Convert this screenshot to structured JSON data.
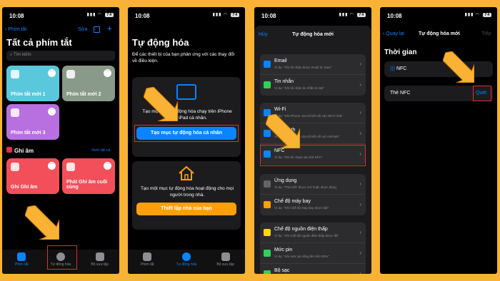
{
  "status": {
    "time": "10:08",
    "battery": "74"
  },
  "p1": {
    "back": "Phím tắt",
    "edit": "Sửa",
    "title": "Tất cả phím tắt",
    "search_placeholder": "Tìm kiếm",
    "cards": [
      "Phím tắt mới 1",
      "Phím tắt mới 2",
      "Phím tắt mới 3"
    ],
    "section": "Ghi âm",
    "see_all": "Xem tất cả",
    "rec_cards": [
      "Ghi Ghi âm",
      "Phát Ghi âm cuối cùng"
    ],
    "tabs": [
      "Phím tắt",
      "Tự động hóa",
      "Bộ sưu tập"
    ]
  },
  "p2": {
    "title": "Tự động hóa",
    "desc": "Để các thiết bị của bạn phản ứng với các thay đổi về điều kiện.",
    "personal_desc": "Tạo một mục tự động hóa chạy trên iPhone hoặc iPad cá nhân.",
    "personal_btn": "Tạo mục tự động hóa cá nhân",
    "home_desc": "Tạo một mục tự động hóa hoạt động cho mọi người trong nhà.",
    "home_btn": "Thiết lập nhà của bạn",
    "tabs": [
      "Phím tắt",
      "Tự động hóa",
      "Bộ sưu tập"
    ]
  },
  "p3": {
    "cancel": "Hủy",
    "title": "Tự động hóa mới",
    "rows_a": [
      {
        "t": "Email",
        "s": "Ví dụ: \"Khi tôi nhận được email từ Jane\""
      },
      {
        "t": "Tin nhắn",
        "s": "Ví dụ: \"Khi tôi nhận tin nhắn từ Mẹ\""
      }
    ],
    "rows_b": [
      {
        "t": "Wi-Fi",
        "s": "Ví dụ: \"Khi iPhone của tôi kết nối vào Wi-Fi nhà\""
      },
      {
        "t": "Bluetooth",
        "s": "Ví dụ: \"Khi iPhone của tôi kết nối với AirPods\""
      },
      {
        "t": "NFC",
        "s": "Ví dụ: \"Khi tôi chạm vào thẻ NFC\""
      }
    ],
    "rows_c": [
      {
        "t": "Ứng dụng",
        "s": "Ví dụ: \"Thời tiết\" được mở hoặc được đóng"
      },
      {
        "t": "Chế độ máy bay",
        "s": "Ví dụ: \"Khi Chế độ máy bay được bật\""
      }
    ],
    "rows_d": [
      {
        "t": "Chế độ nguồn điện thấp",
        "s": "Ví dụ: \"Khi Chế độ nguồn điện thấp được tắt\""
      },
      {
        "t": "Mức pin",
        "s": "Ví dụ: \"Khi mức pin tăng lên trên 50%\""
      },
      {
        "t": "Bộ sạc",
        "s": ""
      }
    ]
  },
  "p4": {
    "back": "Quay lại",
    "title": "Tự động hóa mới",
    "next": "Tiếp",
    "section": "Thời gian",
    "nfc": "NFC",
    "tag_label": "Thẻ NFC",
    "scan": "Quét"
  }
}
